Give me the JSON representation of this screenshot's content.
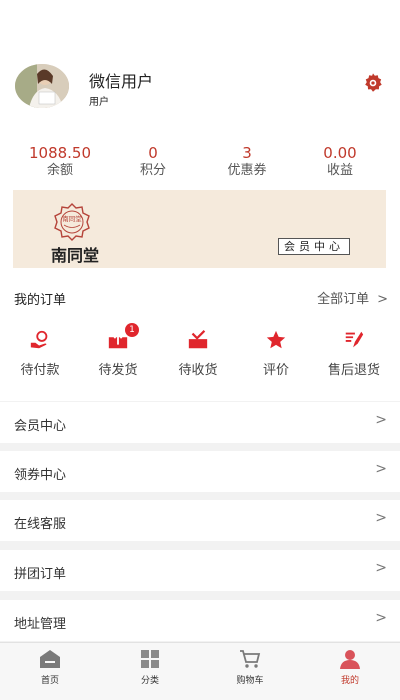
{
  "profile": {
    "name": "微信用户",
    "role": "用户"
  },
  "stats": [
    {
      "value": "1088.50",
      "label": "余额"
    },
    {
      "value": "0",
      "label": "积分"
    },
    {
      "value": "3",
      "label": "优惠券"
    },
    {
      "value": "0.00",
      "label": "收益"
    }
  ],
  "banner": {
    "brand": "南同堂",
    "seal_text": "南同堂",
    "vip_text": "会员中心"
  },
  "orders": {
    "title": "我的订单",
    "all_label": "全部订单",
    "items": [
      {
        "label": "待付款",
        "icon": "pay-icon"
      },
      {
        "label": "待发货",
        "icon": "ship-icon",
        "badge": "1"
      },
      {
        "label": "待收货",
        "icon": "receive-icon"
      },
      {
        "label": "评价",
        "icon": "star-icon"
      },
      {
        "label": "售后退货",
        "icon": "refund-icon"
      }
    ]
  },
  "menu": [
    {
      "label": "会员中心"
    },
    {
      "label": "领券中心"
    },
    {
      "label": "在线客服"
    },
    {
      "label": "拼团订单"
    },
    {
      "label": "地址管理"
    }
  ],
  "tabs": [
    {
      "label": "首页",
      "icon": "home-icon"
    },
    {
      "label": "分类",
      "icon": "category-icon"
    },
    {
      "label": "购物车",
      "icon": "cart-icon"
    },
    {
      "label": "我的",
      "icon": "user-icon",
      "active": true
    }
  ],
  "colors": {
    "accent": "#c0392b",
    "banner_bg": "#f5eadc"
  }
}
